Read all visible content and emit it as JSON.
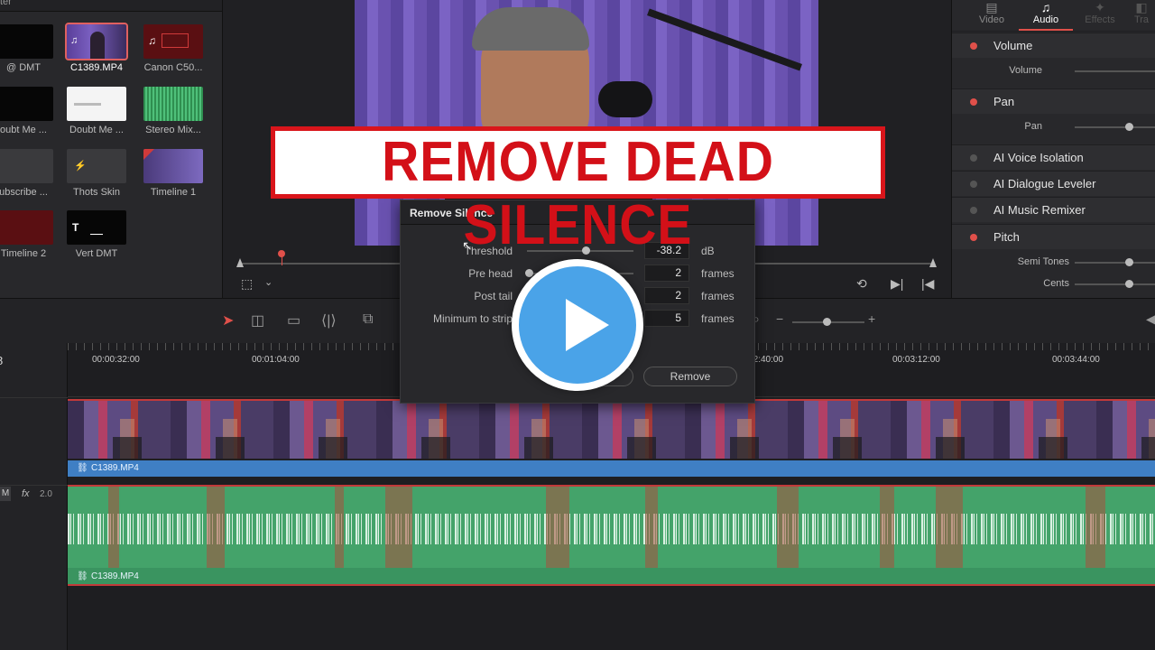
{
  "media_pool": {
    "header": "ter",
    "clips": [
      {
        "label": "@ DMT"
      },
      {
        "label": "C1389.MP4"
      },
      {
        "label": "Canon C50..."
      },
      {
        "label": "oubt Me ..."
      },
      {
        "label": "Doubt Me ..."
      },
      {
        "label": "Stereo Mix..."
      },
      {
        "label": "ubscribe ..."
      },
      {
        "label": "Thots Skin"
      },
      {
        "label": "Timeline 1"
      },
      {
        "label": "Timeline 2"
      },
      {
        "label": "Vert DMT"
      }
    ]
  },
  "inspector": {
    "tabs": [
      {
        "label": "Video"
      },
      {
        "label": "Audio"
      },
      {
        "label": "Effects"
      },
      {
        "label": "Tra"
      }
    ],
    "sections": {
      "volume": {
        "name": "Volume",
        "param": "Volume"
      },
      "pan": {
        "name": "Pan",
        "param": "Pan"
      },
      "voice_isolation": {
        "name": "AI Voice Isolation"
      },
      "dialogue_leveler": {
        "name": "AI Dialogue Leveler"
      },
      "music_remixer": {
        "name": "AI Music Remixer"
      },
      "pitch": {
        "name": "Pitch",
        "param_semitones": "Semi Tones",
        "param_cents": "Cents"
      }
    }
  },
  "timeline": {
    "timecodes": [
      "00:00:32:00",
      "00:01:04:00",
      "00:02:40:00",
      "00:03:12:00",
      "00:03:44:00"
    ],
    "video_clip_label": "C1389.MP4",
    "audio_clip_label": "C1389.MP4",
    "audio_header": {
      "mute": "M",
      "fx": "fx",
      "level": "2.0"
    }
  },
  "dialog": {
    "title": "Remove Silence",
    "rows": {
      "threshold": {
        "label": "Threshold",
        "value": "-38.2",
        "unit": "dB"
      },
      "pre_head": {
        "label": "Pre head",
        "value": "2",
        "unit": "frames"
      },
      "post_tail": {
        "label": "Post tail",
        "value": "2",
        "unit": "frames"
      },
      "min_strip": {
        "label": "Minimum to strip",
        "value": "5",
        "unit": "frames"
      }
    },
    "remove_label": "Remove"
  },
  "banner": {
    "text": "REMOVE DEAD SILENCE"
  },
  "colors": {
    "accent_red": "#e0504a",
    "banner_red": "#d31018",
    "play_blue": "#4aa3e8",
    "audio_green": "#44a36a",
    "video_blue": "#3f7fc4"
  }
}
